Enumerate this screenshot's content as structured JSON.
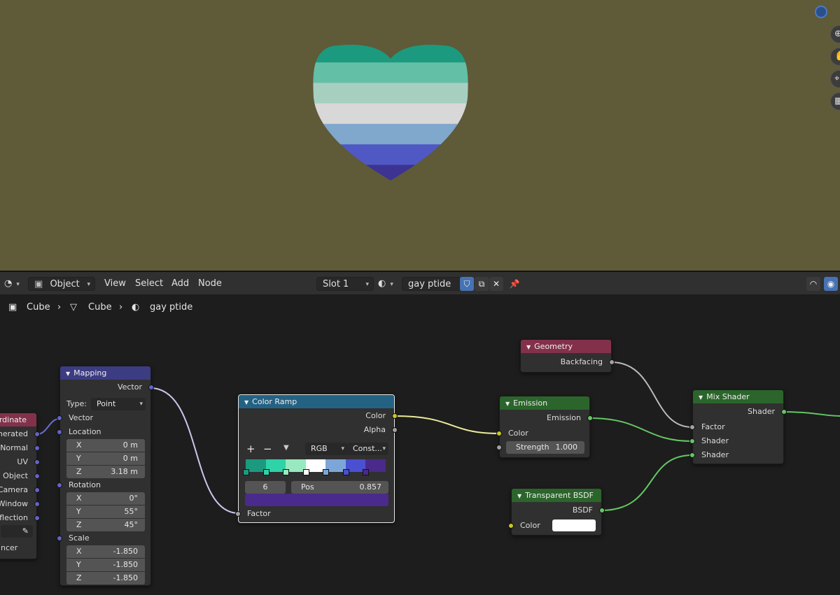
{
  "header": {
    "mode": "Object",
    "menus": [
      "View",
      "Select",
      "Add",
      "Node"
    ],
    "slot": "Slot 1",
    "material_name": "gay ptide"
  },
  "breadcrumb": [
    "Cube",
    "Cube",
    "gay ptide"
  ],
  "heart": {
    "stripe_colors": [
      "#1c9a7f",
      "#63bfa6",
      "#a7cfc0",
      "#d8d8d8",
      "#7fa8cc",
      "#5058c4",
      "#3d3392"
    ]
  },
  "nodes": {
    "texcoord": {
      "title": "ordinate",
      "outputs": [
        "enerated",
        "Normal",
        "UV",
        "Object",
        "Camera",
        "Window",
        "Reflection"
      ],
      "instancer": "ncer"
    },
    "mapping": {
      "title": "Mapping",
      "output": "Vector",
      "type_label": "Type:",
      "type_value": "Point",
      "vector_in": "Vector",
      "location": {
        "label": "Location",
        "x": "0 m",
        "y": "0 m",
        "z": "3.18 m"
      },
      "rotation": {
        "label": "Rotation",
        "x": "0°",
        "y": "55°",
        "z": "45°"
      },
      "scale": {
        "label": "Scale",
        "x": "-1.850",
        "y": "-1.850",
        "z": "-1.850"
      }
    },
    "color_ramp": {
      "title": "Color Ramp",
      "out_color": "Color",
      "out_alpha": "Alpha",
      "color_mode": "RGB",
      "interpolation": "Const...",
      "stop_index": "6",
      "pos_label": "Pos",
      "pos_value": "0.857",
      "active_color": "#4a2a8a",
      "in_factor": "Factor",
      "stops": [
        {
          "pos": 0.0,
          "color": "#1c9a7f"
        },
        {
          "pos": 0.143,
          "color": "#2ed3a8"
        },
        {
          "pos": 0.286,
          "color": "#98e8c0"
        },
        {
          "pos": 0.429,
          "color": "#ffffff"
        },
        {
          "pos": 0.571,
          "color": "#7da6d8"
        },
        {
          "pos": 0.714,
          "color": "#4a50d0"
        },
        {
          "pos": 0.857,
          "color": "#4a2a8a"
        }
      ]
    },
    "geometry": {
      "title": "Geometry",
      "output": "Backfacing"
    },
    "emission": {
      "title": "Emission",
      "output": "Emission",
      "in_color": "Color",
      "strength_label": "Strength",
      "strength_value": "1.000"
    },
    "transparent": {
      "title": "Transparent BSDF",
      "output": "BSDF",
      "in_color": "Color",
      "color": "#ffffff"
    },
    "mix": {
      "title": "Mix Shader",
      "output": "Shader",
      "in_factor": "Factor",
      "in_shader1": "Shader",
      "in_shader2": "Shader"
    }
  }
}
